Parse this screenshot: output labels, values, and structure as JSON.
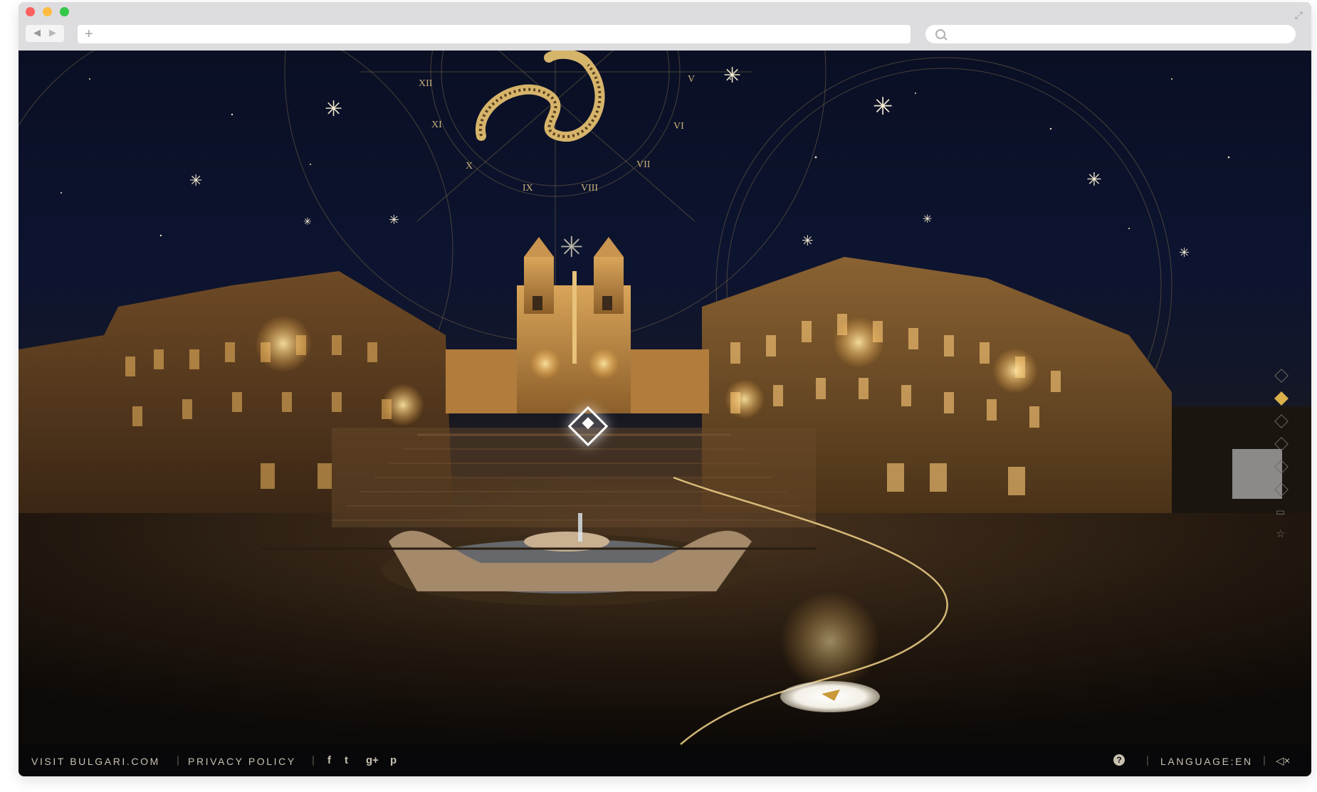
{
  "browser": {
    "back_icon": "◀",
    "forward_icon": "▶",
    "new_tab_icon": "+",
    "url": "",
    "search_placeholder": ""
  },
  "scene": {
    "roman_numerals": [
      "XII",
      "XI",
      "X",
      "IX",
      "VIII",
      "VII",
      "VI",
      "V"
    ],
    "location": "Piazza di Spagna"
  },
  "footer": {
    "visit_link": "VISIT BULGARI.COM",
    "privacy_link": "PRIVACY POLICY",
    "separator": "|",
    "social": [
      "f",
      "t",
      "g+",
      "p"
    ],
    "help_label": "?",
    "language_label": "LANGUAGE:EN",
    "mute_label": "◁×"
  },
  "colors": {
    "gold": "#d9b04a",
    "footer_text": "#c9c2b2",
    "sky": "#0d1430"
  },
  "side_nav": {
    "active_index": 1,
    "items": 6
  }
}
